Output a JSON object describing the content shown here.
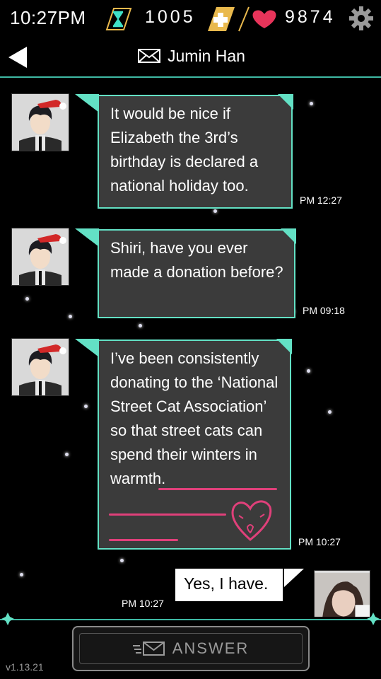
{
  "status": {
    "time": "10:27PM",
    "hourglass_count": "1005",
    "heart_count": "9874",
    "icons": [
      "hourglass-icon",
      "plus-icon",
      "heart-icon",
      "gear-icon"
    ],
    "colors": {
      "hourglass": "#3fe0c8",
      "plus": "#e9b94d",
      "heart": "#e8345a"
    }
  },
  "header": {
    "title": "Jumin Han",
    "icons": [
      "back-arrow-icon",
      "envelope-icon"
    ]
  },
  "messages": [
    {
      "sender": "Jumin Han",
      "text": "It would be nice if Elizabeth the 3rd’s birthday is declared a national holiday too.",
      "time": "PM 12:27"
    },
    {
      "sender": "Jumin Han",
      "text": "Shiri, have you ever made a donation before?",
      "time": "PM 09:18"
    },
    {
      "sender": "Jumin Han",
      "text": "I’ve been consistently donating to the ‘National Street Cat Association’ so that street cats can spend their winters in warmth.",
      "time": "PM 10:27"
    },
    {
      "sender": "me",
      "text": "Yes, I have.",
      "time": "PM 10:27"
    }
  ],
  "answer_button": {
    "label": "ANSWER",
    "icon": "envelope-send-icon"
  },
  "version": "v1.13.21",
  "colors": {
    "accent": "#63e1c5",
    "bubble": "#3b3b3b",
    "annotation": "#e0407a"
  }
}
